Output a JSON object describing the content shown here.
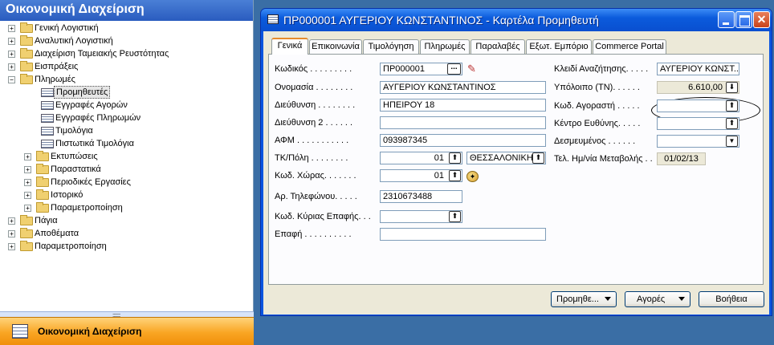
{
  "nav": {
    "header": "Οικονομική Διαχείριση",
    "footer_label": "Οικονομική Διαχείριση",
    "splitter_grip": "::::::::::",
    "tree": [
      {
        "label": "Γενική Λογιστική",
        "level": 0,
        "kind": "folder",
        "expander": "+"
      },
      {
        "label": "Αναλυτική Λογιστική",
        "level": 0,
        "kind": "folder",
        "expander": "+"
      },
      {
        "label": "Διαχείριση Ταμειακής Ρευστότητας",
        "level": 0,
        "kind": "folder",
        "expander": "+"
      },
      {
        "label": "Εισπράξεις",
        "level": 0,
        "kind": "folder",
        "expander": "+"
      },
      {
        "label": "Πληρωμές",
        "level": 0,
        "kind": "folder",
        "expander": "−"
      },
      {
        "label": "Προμηθευτές",
        "level": 1,
        "kind": "form",
        "expander": "",
        "selected": true
      },
      {
        "label": "Εγγραφές Αγορών",
        "level": 1,
        "kind": "form",
        "expander": ""
      },
      {
        "label": "Εγγραφές Πληρωμών",
        "level": 1,
        "kind": "form",
        "expander": ""
      },
      {
        "label": "Τιμολόγια",
        "level": 1,
        "kind": "form",
        "expander": ""
      },
      {
        "label": "Πιστωτικά Τιμολόγια",
        "level": 1,
        "kind": "form",
        "expander": ""
      },
      {
        "label": "Εκτυπώσεις",
        "level": 1,
        "kind": "folder",
        "expander": "+"
      },
      {
        "label": "Παραστατικά",
        "level": 1,
        "kind": "folder",
        "expander": "+"
      },
      {
        "label": "Περιοδικές Εργασίες",
        "level": 1,
        "kind": "folder",
        "expander": "+"
      },
      {
        "label": "Ιστορικό",
        "level": 1,
        "kind": "folder",
        "expander": "+"
      },
      {
        "label": "Παραμετροποίηση",
        "level": 1,
        "kind": "folder",
        "expander": "+"
      },
      {
        "label": "Πάγια",
        "level": 0,
        "kind": "folder",
        "expander": "+"
      },
      {
        "label": "Αποθέματα",
        "level": 0,
        "kind": "folder",
        "expander": "+"
      },
      {
        "label": "Παραμετροποίηση",
        "level": 0,
        "kind": "folder",
        "expander": "+"
      }
    ]
  },
  "window": {
    "title": "ΠΡ000001 ΑΥΓΕΡΙΟΥ ΚΩΝΣΤΑΝΤΙΝΟΣ - Καρτέλα Προμηθευτή",
    "close_glyph": "✕"
  },
  "tabs": [
    "Γενικά",
    "Επικοινωνία",
    "Τιμολόγηση",
    "Πληρωμές",
    "Παραλαβές",
    "Εξωτ. Εμπόριο",
    "Commerce Portal"
  ],
  "active_tab": "Γενικά",
  "form": {
    "code_label": "Κωδικός . . . . . . . . .",
    "code_value": "ΠΡ000001",
    "name_label": "Ονομασία . . . . . . . .",
    "name_value": "ΑΥΓΕΡΙΟΥ ΚΩΝΣΤΑΝΤΙΝΟΣ",
    "address_label": "Διεύθυνση . . . . . . . .",
    "address_value": "ΗΠΕΙΡΟΥ 18",
    "address2_label": "Διεύθυνση 2 . . . . . .",
    "address2_value": "",
    "vat_label": "ΑΦΜ . . . . . . . . . . .",
    "vat_value": "093987345",
    "postcode_label": "ΤΚ/Πόλη . . . . . . . .",
    "postcode_value": "01",
    "city_value": "ΘΕΣΣΑΛΟΝΙΚΗ",
    "country_label": "Κωδ. Χώρας. . . . . . .",
    "country_value": "01",
    "phone_label": "Αρ. Τηλεφώνου. . . . .",
    "phone_value": "2310673488",
    "contact_code_label": "Κωδ. Κύριας Επαφής. . .",
    "contact_code_value": "",
    "contact_label": "Επαφή . . . . . . . . . .",
    "contact_value": "",
    "search_key_label": "Κλειδί Αναζήτησης. . . . .",
    "search_key_value": "ΑΥΓΕΡΙΟΥ ΚΩΝΣΤ...",
    "balance_label": "Υπόλοιπο (ΤΝ). . . . . .",
    "balance_value": "6.610,00",
    "buyer_label": "Κωδ. Αγοραστή . . . . .",
    "buyer_value": "",
    "resp_label": "Κέντρο Ευθύνης. . . . .",
    "resp_value": "",
    "blocked_label": "Δεσμευμένος . . . . . .",
    "blocked_value": "",
    "modified_label": "Τελ. Ημ/νία Μεταβολής . .",
    "modified_value": "01/02/13"
  },
  "buttons": {
    "vendor": "Προμηθε...",
    "purchases": "Αγορές",
    "help": "Βοήθεια"
  },
  "glyphs": {
    "lookup_up": "⬆",
    "drill_down": "⬇",
    "dropdown": "▼",
    "ellipsis": "...",
    "pencil": "✎",
    "map": "✦"
  }
}
